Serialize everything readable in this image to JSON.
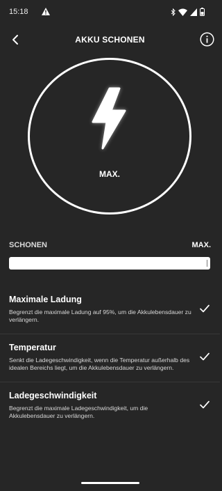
{
  "status_bar": {
    "time": "15:18",
    "icons": [
      "warning-icon",
      "bluetooth-icon",
      "wifi-icon",
      "signal-icon",
      "battery-icon"
    ]
  },
  "header": {
    "title": "AKKU SCHONEN",
    "back_icon": "chevron-left-icon",
    "info_icon": "info-icon"
  },
  "gauge": {
    "icon": "lightning-bolt-icon",
    "label": "MAX."
  },
  "slider": {
    "min_label": "SCHONEN",
    "max_label": "MAX.",
    "value": 1.0
  },
  "options": [
    {
      "title": "Maximale Ladung",
      "description": "Begrenzt die maximale Ladung auf 95%, um die Akkulebensdauer zu verlängern.",
      "checked": true
    },
    {
      "title": "Temperatur",
      "description": "Senkt die Ladegeschwindigkeit, wenn die Temperatur außerhalb des idealen Bereichs liegt, um die Akkulebensdauer zu verlängern.",
      "checked": true
    },
    {
      "title": "Ladegeschwindigkeit",
      "description": "Begrenzt die maximale Ladegeschwindigkeit, um die Akkulebensdauer zu verlängern.",
      "checked": true
    }
  ],
  "colors": {
    "background": "#262626",
    "foreground": "#ffffff",
    "divider": "#383838"
  }
}
